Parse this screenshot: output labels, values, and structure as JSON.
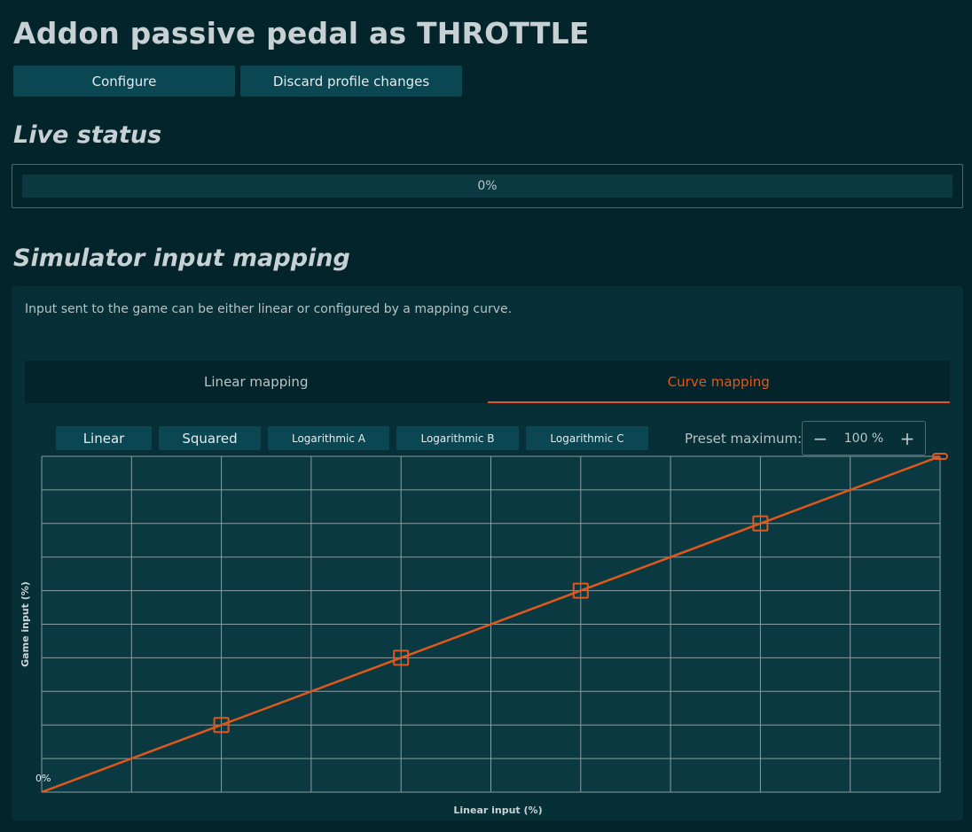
{
  "header": {
    "title": "Addon passive pedal as THROTTLE",
    "configure_label": "Configure",
    "discard_label": "Discard profile changes"
  },
  "live_status": {
    "title": "Live status",
    "progress": 0,
    "progress_label": "0%",
    "fill_color": "#e0591a"
  },
  "mapping": {
    "title": "Simulator input mapping",
    "description": "Input sent to the game can be either linear or configured by a mapping curve.",
    "tabs": [
      {
        "label": "Linear mapping",
        "active": false
      },
      {
        "label": "Curve mapping",
        "active": true
      }
    ],
    "presets": [
      "Linear",
      "Squared",
      "Logarithmic A",
      "Logarithmic B",
      "Logarithmic C"
    ],
    "preset_max_label": "Preset maximum:",
    "preset_max_value": "100 %",
    "minus_icon": "minus-icon",
    "plus_icon": "plus-icon"
  },
  "colors": {
    "accent": "#e0591a",
    "background": "#03242a",
    "panel": "#072f37",
    "button": "#0b4653",
    "plot_bg": "#0b3942"
  },
  "chart_data": {
    "type": "line",
    "xlabel": "Linear input (%)",
    "ylabel": "Game input (%)",
    "origin_label": "0%",
    "xlim": [
      0,
      100
    ],
    "ylim": [
      0,
      100
    ],
    "grid": true,
    "series": [
      {
        "x": [
          0,
          20,
          40,
          60,
          80,
          100
        ],
        "y": [
          0,
          20,
          40,
          60,
          80,
          100
        ],
        "control_points": [
          20,
          40,
          60,
          80,
          100
        ]
      }
    ]
  }
}
